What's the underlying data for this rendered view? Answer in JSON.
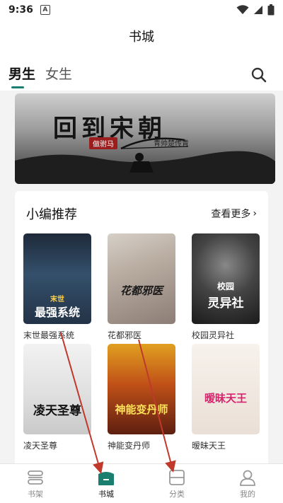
{
  "status_bar": {
    "time": "9:36",
    "notif_letter": "A"
  },
  "header": {
    "title": "书城"
  },
  "tabs": [
    {
      "label": "男生",
      "active": true
    },
    {
      "label": "女生",
      "active": false
    }
  ],
  "banner": {
    "title": "回到宋朝",
    "badge": "做驸马",
    "subtitle": "青帅楚传青"
  },
  "recommend": {
    "title": "小编推荐",
    "more_label": "查看更多",
    "books": [
      {
        "name": "末世最强系统",
        "cover_text": "最强系统",
        "cover_small": "末世"
      },
      {
        "name": "花都邪医",
        "cover_text": "花都邪医",
        "cover_small": ""
      },
      {
        "name": "校园灵异社",
        "cover_text": "灵异社",
        "cover_small": "校园"
      },
      {
        "name": "凌天圣尊",
        "cover_text": "凌天圣尊",
        "cover_small": ""
      },
      {
        "name": "神能变丹师",
        "cover_text": "神能变丹师",
        "cover_small": ""
      },
      {
        "name": "暧昧天王",
        "cover_text": "暧昧天王",
        "cover_small": ""
      }
    ]
  },
  "bottom_nav": [
    {
      "label": "书架",
      "icon": "bookshelf-icon",
      "active": false
    },
    {
      "label": "书城",
      "icon": "bookstore-icon",
      "active": true
    },
    {
      "label": "分类",
      "icon": "category-icon",
      "active": false
    },
    {
      "label": "我的",
      "icon": "profile-icon",
      "active": false
    }
  ],
  "colors": {
    "accent": "#1a7f6e",
    "annotation_arrow": "#c0392b"
  }
}
